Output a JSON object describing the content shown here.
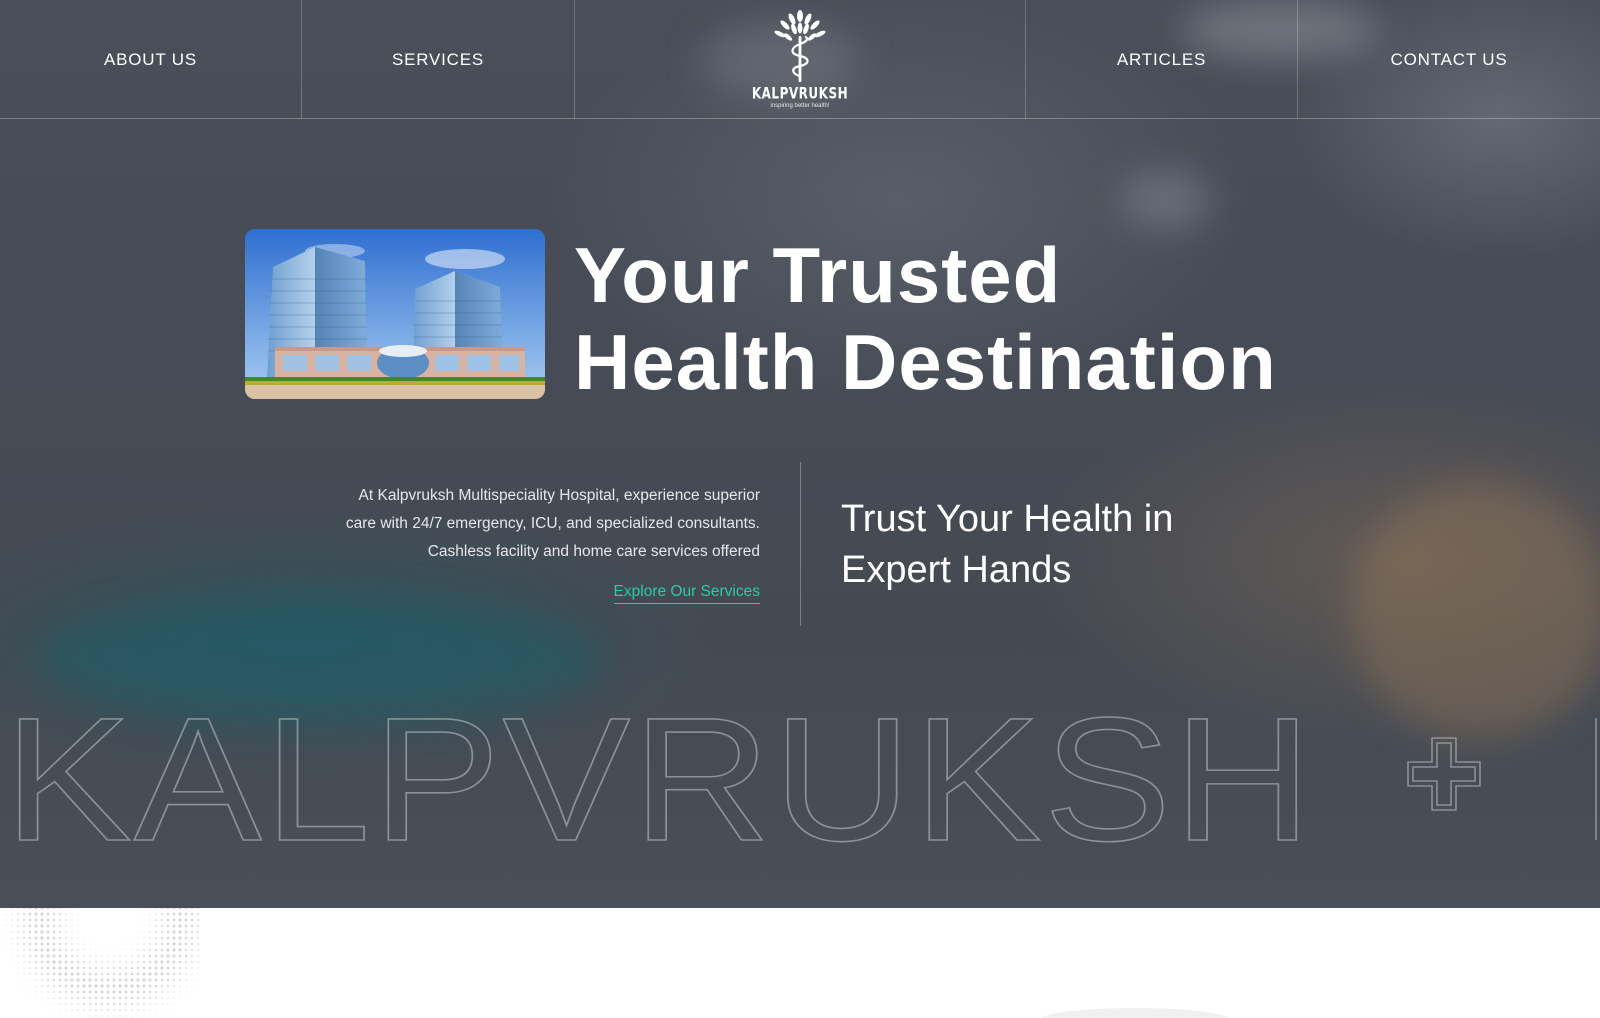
{
  "nav": {
    "about": "ABOUT US",
    "services": "SERVICES",
    "articles": "ARTICLES",
    "contact": "CONTACT US"
  },
  "logo": {
    "name": "KALPVRUKSH",
    "tagline": "inspiring better health!"
  },
  "hero": {
    "headline_line1": "Your Trusted",
    "headline_line2": "Health Destination",
    "description_line1": "At Kalpvruksh Multispeciality Hospital, experience superior",
    "description_line2": "care with 24/7 emergency, ICU, and specialized consultants.",
    "description_line3": "Cashless facility and home care services offered",
    "cta": "Explore Our Services",
    "trust_line1": "Trust Your Health in",
    "trust_line2": "Expert Hands",
    "watermark": "KALPVRUKSH"
  },
  "colors": {
    "accent": "#2ec9a6",
    "hero_overlay": "#474b55"
  },
  "icons": [
    "tree-caduceus-logo-icon",
    "medical-cross-outline-icon"
  ]
}
